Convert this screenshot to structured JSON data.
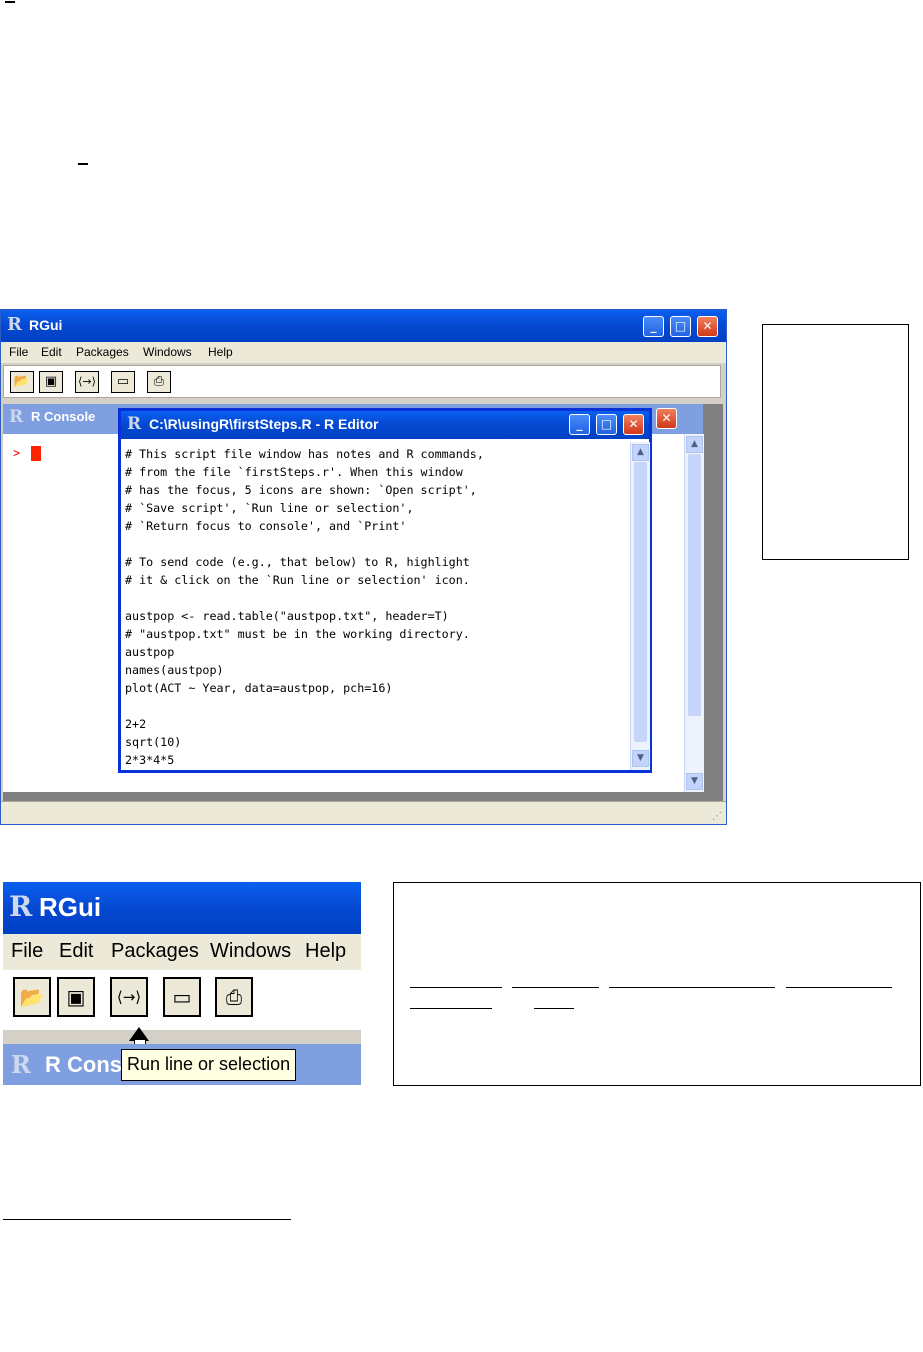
{
  "rgui": {
    "title": "RGui",
    "menu": [
      "File",
      "Edit",
      "Packages",
      "Windows",
      "Help"
    ],
    "toolbar_icons": [
      "open-script-icon",
      "save-script-icon",
      "run-line-or-selection-icon",
      "return-focus-to-console-icon",
      "print-icon"
    ],
    "console": {
      "title": "R Console",
      "prompt": ">"
    },
    "editor": {
      "title": "C:\\R\\usingR\\firstSteps.R - R Editor",
      "code": "# This script file window has notes and R commands,\n# from the file `firstSteps.r'. When this window\n# has the focus, 5 icons are shown: `Open script',\n# `Save script', `Run line or selection',\n# `Return focus to console', and `Print'\n\n# To send code (e.g., that below) to R, highlight\n# it & click on the `Run line or selection' icon.\n\naustpop <- read.table(\"austpop.txt\", header=T)\n# \"austpop.txt\" must be in the working directory.\naustpop\nnames(austpop)\nplot(ACT ~ Year, data=austpop, pch=16)\n\n2+2\nsqrt(10)\n2*3*4*5"
    },
    "colors": {
      "titlebar": "#0548d0",
      "prompt": "#ff0000",
      "cursor": "#ff2200"
    }
  },
  "zoom_view": {
    "title": "RGui",
    "menu": [
      "File",
      "Edit",
      "Packages",
      "Windows",
      "Help"
    ],
    "console_title": "R Cons",
    "tooltip": "Run line or selection"
  }
}
